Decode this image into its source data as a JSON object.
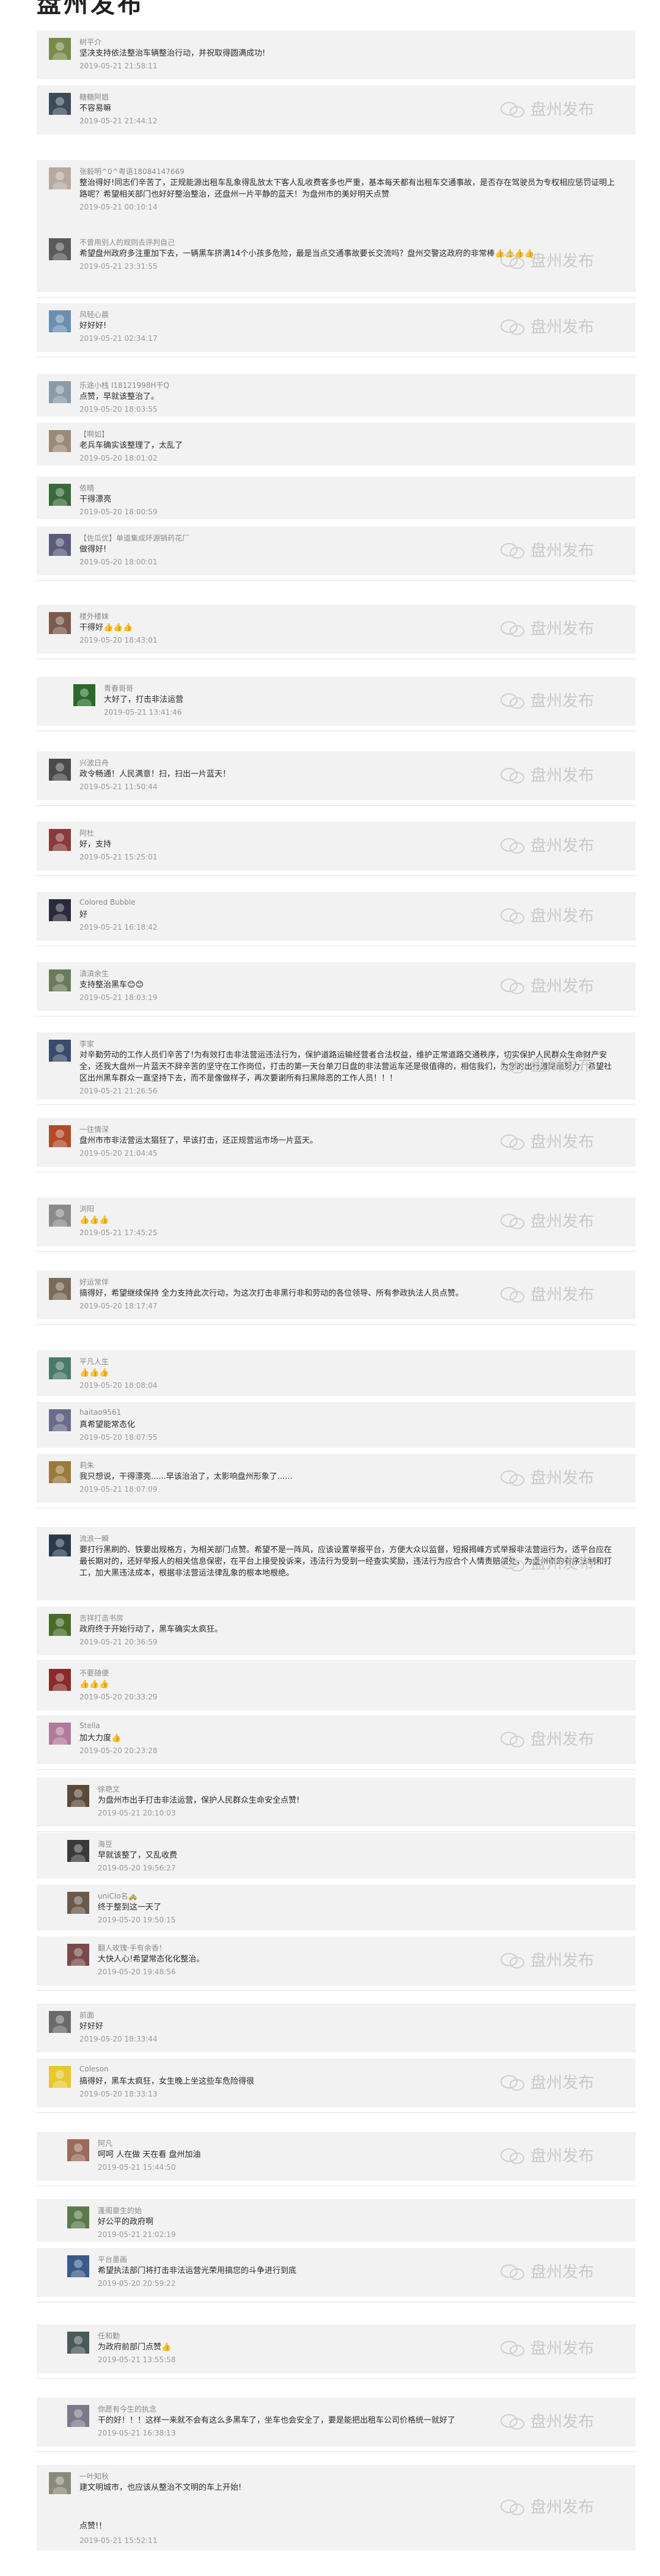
{
  "page": {
    "title": "盘州发布"
  },
  "watermark": {
    "text": "盘州发布"
  },
  "comments": [
    {
      "name": "树平介",
      "text": "坚决支持依法整治车辆整治行动，并祝取得圆满成功!",
      "date": "2019-05-21 21:58:11",
      "avatar_color": "#7a8a4a"
    },
    {
      "name": "糖糖阿姐",
      "text": "不容易嘛",
      "date": "2019-05-21 21:44:12",
      "avatar_color": "#3c4b5a"
    },
    {
      "name": "张毅明^0^粤语18084147669",
      "text": "整治得好!同志们辛苦了，正规能源出租车乱象得乱放太下客人乱收费客多也严重，基本每天都有出租车交通事故，是否存在驾驶员为专权相应惩罚证明上路呢？希望相关部门也好好整治整治，还盘州一片平静的蓝天！为盘州市的美好明天点赞",
      "date": "2019-05-21 00:10:14",
      "avatar_color": "#b7a9a0"
    },
    {
      "name": "不曾用别人的规则去评判自己",
      "text": "希望盘州政府多注重加下去，一辆黑车挤满14个小孩多危险，最是当点交通事故要长交流吗？盘州交警这政府的非常棒👍👍👍👍",
      "date": "2019-05-21 23:31:55",
      "avatar_color": "#5a5a5a"
    },
    {
      "name": "风轻心晨",
      "text": "好好好!",
      "date": "2019-05-21 02:34:17",
      "avatar_color": "#6b8fb0"
    },
    {
      "name": "乐途小栈 I18121998H千Q",
      "text": "点赞，早就该整治了。",
      "date": "2019-05-20 18:03:55",
      "avatar_color": "#8a9aa8"
    },
    {
      "name": "【啊如】",
      "text": "老兵车确实该整理了，太乱了",
      "date": "2019-05-20 18:01:02",
      "avatar_color": "#9a8a7a"
    },
    {
      "name": "依晴",
      "text": "干得漂亮",
      "date": "2019-05-20 18:00:59",
      "avatar_color": "#3a6a3a"
    },
    {
      "name": "【佐瓜优】单道集成环源销药花厂",
      "text": "做得好!",
      "date": "2019-05-20 18:00:01",
      "avatar_color": "#5a5a7a"
    },
    {
      "name": "楼外楼妹",
      "text": "干得好👍👍👍",
      "date": "2019-05-20 18:43:01",
      "avatar_color": "#7a5a4a"
    },
    {
      "name": "青春哥哥",
      "text": "大好了，打击非法运营",
      "date": "2019-05-21 13:41:46",
      "avatar_color": "#2a6a2a"
    },
    {
      "name": "兴波日舟",
      "text": "政令畅通！人民满意！扫，扫出一片蓝天！",
      "date": "2019-05-21 11:50:44",
      "avatar_color": "#4a4a4a"
    },
    {
      "name": "阿杜",
      "text": "好，支持",
      "date": "2019-05-21 15:25:01",
      "avatar_color": "#8a3a3a"
    },
    {
      "name": "Colored Bubble",
      "text": "好",
      "date": "2019-05-21 16:18:42",
      "avatar_color": "#2a2a3a"
    },
    {
      "name": "滇滇余生",
      "text": "支持整治黑车😊😊",
      "date": "2019-05-21 18:03:19",
      "avatar_color": "#6a7a5a"
    },
    {
      "name": "李家",
      "text": "对辛勤劳动的工作人员们辛苦了!为有效打击非法营运违法行为，保护道路运输经营者合法权益，维护正常道路交通秩序，切实保护人民群众生命财产安全，还我大盘州一片蓝天不辞辛苦的坚守在工作岗位，打击的第一天台单刀日盘的非法营运车还是很值得的，相信我们，为您的出行道路而努力，希望社区出州黑车群众一直坚持下去，而不是像做样子，再次要谢所有扫黑除恶的工作人员！！！",
      "date": "2019-05-21 21:26:56",
      "avatar_color": "#3a4a6a"
    },
    {
      "name": "一往情深",
      "text": "盘州市市非法营运太猖狂了，早该打击，还正规营运市场一片蓝天。",
      "date": "2019-05-20 21:04:45",
      "avatar_color": "#b04a2a"
    },
    {
      "name": "浏阳",
      "text": "👍👍👍",
      "date": "2019-05-21 17:45:25",
      "avatar_color": "#8a8a8a"
    },
    {
      "name": "好运常伴",
      "text": "搞得好，希望继续保持 全力支持此次行动，为这次打击非黑行非和劳动的各位领导、所有参政执法人员点赞。",
      "date": "2019-05-20 18:17:47",
      "avatar_color": "#7a6a5a"
    },
    {
      "name": "平凡人生",
      "text": "👍👍👍",
      "date": "2019-05-20 18:08:04",
      "avatar_color": "#4a7a6a"
    },
    {
      "name": "haitao9561",
      "text": "真希望能常态化",
      "date": "2019-05-20 18:07:55",
      "avatar_color": "#6a6a8a"
    },
    {
      "name": "莉朱",
      "text": "我只想说，干得漂亮......早该治治了，太影响盘州形象了......",
      "date": "2019-05-21 18:07:09",
      "avatar_color": "#9a7a3a"
    },
    {
      "name": "流浪一瞬",
      "text": "要打行黑刷的、铁要出规格方，为相关部门点赞。希望不是一阵风，应该设置举报平台，方便大众以监督，短报揭峰方式举报非法营运行为，适平台应在最长期对的，还好举报人的相关信息保密，在平台上接受投诉来，违法行为受到一经查实奖励，违法行为应合个人情责赔偿处，为盘州市的有序法制和打工，加大黑违法成本，根据非法营运法律乱象的根本地根绝。",
      "date": "",
      "avatar_color": "#2a3a4a"
    },
    {
      "name": "吉祥打造书房",
      "text": "政府终于开始行动了，黑车确实太疯狂。",
      "date": "2019-05-21 20:36:59",
      "avatar_color": "#4a6a2a"
    },
    {
      "name": "不要随便",
      "text": "👍👍👍",
      "date": "2019-05-20 20:33:29",
      "avatar_color": "#8a2a2a"
    },
    {
      "name": "Stella",
      "text": "加大力度👍",
      "date": "2019-05-20 20:23:28",
      "avatar_color": "#b07a9a"
    },
    {
      "name": "徐艳文",
      "text": "为盘州市出手打击非法运营，保护人民群众生命安全点赞!",
      "date": "2019-05-21 20:10:03",
      "avatar_color": "#5a4a3a"
    },
    {
      "name": "海豆",
      "text": "早就该整了，又乱收费",
      "date": "2019-05-20 19:56:27",
      "avatar_color": "#3a3a3a"
    },
    {
      "name": "uniClo名🚕",
      "text": "终于整到这一天了",
      "date": "2019-05-20 19:50:15",
      "avatar_color": "#6a5a4a"
    },
    {
      "name": "翻人玫瑰·手有余香！",
      "text": "大快人心!希望常态化化整治。",
      "date": "2019-05-20 19:48:56",
      "avatar_color": "#7a4a4a"
    },
    {
      "name": "前面",
      "text": "好好好",
      "date": "2019-05-20 18:33:44",
      "avatar_color": "#6a6a6a"
    },
    {
      "name": "Coleson",
      "text": "搞得好，黑车太疯狂，女生晚上坐这些车危险得很",
      "date": "2019-05-20 18:33:13",
      "avatar_color": "#e8c830"
    },
    {
      "name": "阿凡",
      "text": "呵呵 人在做 天在看 盘州加油",
      "date": "2019-05-21 15:44:50",
      "avatar_color": "#9a6a5a"
    },
    {
      "name": "蓬阁豪生的始",
      "text": "好公平的政府啊",
      "date": "2019-05-21 21:02:19",
      "avatar_color": "#5a7a4a"
    },
    {
      "name": "平台墨画",
      "text": "希望执法部门将打击非法运营光荣用搞您的斗争进行到底",
      "date": "2019-05-20 20:59:22",
      "avatar_color": "#3a5a8a"
    },
    {
      "name": "任和勤",
      "text": "为政府前部门点赞👍",
      "date": "2019-05-21 13:55:58",
      "avatar_color": "#4a5a5a"
    },
    {
      "name": "你愿有今生的执念",
      "text": "干的好！！！这样一来就不会有这么多黑车了，坐车也会安全了，要是能把出租车公司价格统一就好了",
      "date": "2019-05-21 16:38:13",
      "avatar_color": "#7a7a8a"
    },
    {
      "name": "一叶知秋",
      "text": "建文明城市，也应该从整治不文明的车上开始!",
      "text2": "点赞!！",
      "date": "2019-05-21 15:52:11",
      "avatar_color": "#8a8a7a"
    }
  ]
}
